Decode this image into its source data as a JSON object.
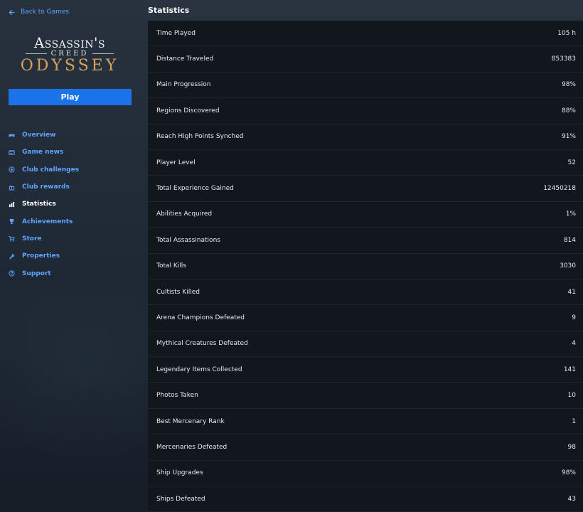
{
  "back": {
    "label": "Back to Games"
  },
  "logo": {
    "line1": "Assassin's",
    "line2": "CREED",
    "line3": "ODYSSEY"
  },
  "play": {
    "label": "Play"
  },
  "nav": [
    {
      "label": "Overview",
      "icon": "gamepad-icon",
      "active": false
    },
    {
      "label": "Game news",
      "icon": "news-icon",
      "active": false
    },
    {
      "label": "Club challenges",
      "icon": "target-icon",
      "active": false
    },
    {
      "label": "Club rewards",
      "icon": "gift-icon",
      "active": false
    },
    {
      "label": "Statistics",
      "icon": "bar-chart-icon",
      "active": true
    },
    {
      "label": "Achievements",
      "icon": "trophy-icon",
      "active": false
    },
    {
      "label": "Store",
      "icon": "cart-icon",
      "active": false
    },
    {
      "label": "Properties",
      "icon": "wrench-icon",
      "active": false
    },
    {
      "label": "Support",
      "icon": "help-icon",
      "active": false
    }
  ],
  "page_title": "Statistics",
  "stats": [
    {
      "label": "Time Played",
      "value": "105 h"
    },
    {
      "label": "Distance Traveled",
      "value": "853383"
    },
    {
      "label": "Main Progression",
      "value": "98%"
    },
    {
      "label": "Regions Discovered",
      "value": "88%"
    },
    {
      "label": "Reach High Points Synched",
      "value": "91%"
    },
    {
      "label": "Player Level",
      "value": "52"
    },
    {
      "label": "Total Experience Gained",
      "value": "12450218"
    },
    {
      "label": "Abilities Acquired",
      "value": "1%"
    },
    {
      "label": "Total Assassinations",
      "value": "814"
    },
    {
      "label": "Total Kills",
      "value": "3030"
    },
    {
      "label": "Cultists Killed",
      "value": "41"
    },
    {
      "label": "Arena Champions Defeated",
      "value": "9"
    },
    {
      "label": "Mythical Creatures Defeated",
      "value": "4"
    },
    {
      "label": "Legendary Items Collected",
      "value": "141"
    },
    {
      "label": "Photos Taken",
      "value": "10"
    },
    {
      "label": "Best Mercenary Rank",
      "value": "1"
    },
    {
      "label": "Mercenaries Defeated",
      "value": "98"
    },
    {
      "label": "Ship Upgrades",
      "value": "98%"
    },
    {
      "label": "Ships Defeated",
      "value": "43"
    }
  ],
  "colors": {
    "accent": "#1a73e8",
    "link": "#5ea3ff",
    "panel": "#12171e"
  }
}
